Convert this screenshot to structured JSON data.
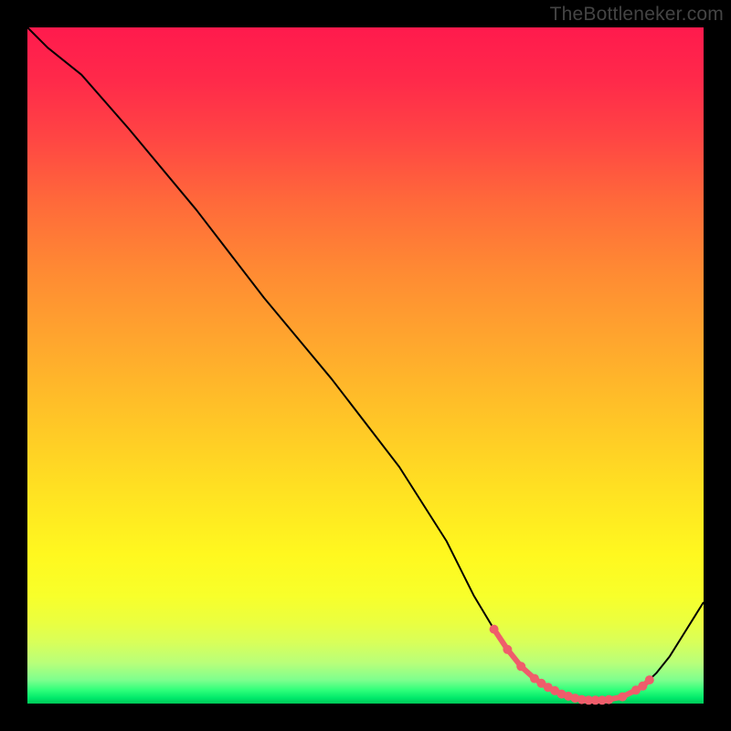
{
  "watermark": "TheBottleneker.com",
  "chart_data": {
    "type": "line",
    "title": "",
    "xlabel": "",
    "ylabel": "",
    "xlim": [
      0,
      100
    ],
    "ylim": [
      0,
      100
    ],
    "x": [
      0,
      3,
      8,
      15,
      25,
      35,
      45,
      55,
      62,
      66,
      69,
      71,
      73,
      75,
      77,
      79,
      81,
      83,
      85,
      87,
      89,
      91,
      93,
      95,
      97,
      100
    ],
    "values": [
      100,
      97,
      93,
      85,
      73,
      60,
      48,
      35,
      24,
      16,
      11,
      8,
      5.5,
      3.7,
      2.4,
      1.4,
      0.8,
      0.5,
      0.5,
      0.8,
      1.4,
      2.6,
      4.5,
      7,
      10.2,
      15
    ],
    "markers_x": [
      69,
      71,
      73,
      75,
      76,
      77,
      78,
      79,
      80,
      81,
      82,
      83,
      84,
      85,
      86,
      88,
      90,
      91,
      92
    ],
    "markers_y": [
      11,
      8,
      5.5,
      3.7,
      3.0,
      2.4,
      1.9,
      1.4,
      1.1,
      0.8,
      0.6,
      0.5,
      0.5,
      0.5,
      0.6,
      1.0,
      2.0,
      2.6,
      3.5
    ],
    "marker_color": "#ef5d6b",
    "curve_color": "#000000"
  }
}
